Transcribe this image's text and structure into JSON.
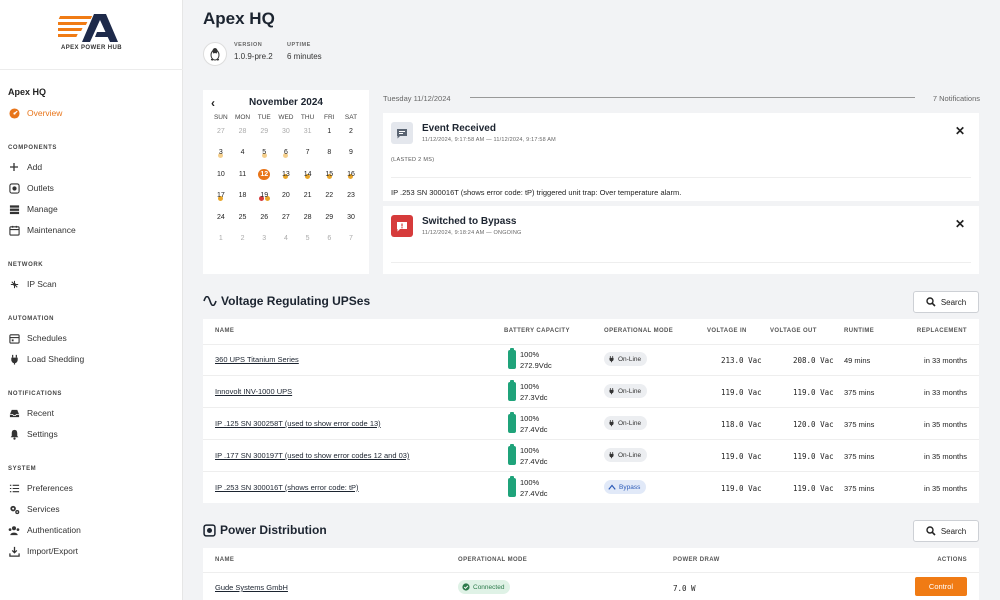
{
  "app": {
    "logo_text": "APEX POWER HUB"
  },
  "header": {
    "title": "Apex HQ",
    "version_label": "VERSION",
    "version": "1.0.9-pre.2",
    "uptime_label": "UPTIME",
    "uptime": "6 minutes"
  },
  "sidebar": {
    "site": "Apex HQ",
    "overview": "Overview",
    "sections": {
      "components": "COMPONENTS",
      "network": "NETWORK",
      "automation": "AUTOMATION",
      "notifications": "NOTIFICATIONS",
      "system": "SYSTEM"
    },
    "items": {
      "add": "Add",
      "outlets": "Outlets",
      "manage": "Manage",
      "maintenance": "Maintenance",
      "ip_scan": "IP Scan",
      "schedules": "Schedules",
      "load_shedding": "Load Shedding",
      "recent": "Recent",
      "settings": "Settings",
      "preferences": "Preferences",
      "services": "Services",
      "authentication": "Authentication",
      "import_export": "Import/Export"
    }
  },
  "calendar": {
    "title": "November 2024",
    "days": [
      "SUN",
      "MON",
      "TUE",
      "WED",
      "THU",
      "FRI",
      "SAT"
    ],
    "weeks": [
      [
        "27",
        "28",
        "29",
        "30",
        "31",
        "1",
        "2"
      ],
      [
        "3",
        "4",
        "5",
        "6",
        "7",
        "8",
        "9"
      ],
      [
        "10",
        "11",
        "12",
        "13",
        "14",
        "15",
        "16"
      ],
      [
        "17",
        "18",
        "19",
        "20",
        "21",
        "22",
        "23"
      ],
      [
        "24",
        "25",
        "26",
        "27",
        "28",
        "29",
        "30"
      ],
      [
        "1",
        "2",
        "3",
        "4",
        "5",
        "6",
        "7"
      ]
    ],
    "today": "12"
  },
  "notifications": {
    "date": "Tuesday 11/12/2024",
    "count": "7 Notifications",
    "items": [
      {
        "title": "Event Received",
        "time": "11/12/2024, 9:17:58 AM   —   11/12/2024, 9:17:58 AM",
        "lasted": "(LASTED 2 MS)",
        "message": "IP .253 SN 300016T (shows error code: tP) triggered unit trap: Over temperature alarm."
      },
      {
        "title": "Switched to Bypass",
        "time": "11/12/2024, 9:18:24 AM   —   ONGOING"
      }
    ]
  },
  "ups": {
    "title": "Voltage Regulating UPSes",
    "search_label": "Search",
    "columns": [
      "NAME",
      "BATTERY CAPACITY",
      "OPERATIONAL MODE",
      "VOLTAGE IN",
      "VOLTAGE OUT",
      "RUNTIME",
      "REPLACEMENT"
    ],
    "rows": [
      {
        "name": "360 UPS Titanium Series",
        "battery_pct": "100%",
        "battery_v": "272.9Vdc",
        "mode": "On-Line",
        "vin": "213.0 Vac",
        "vout": "208.0 Vac",
        "runtime": "49 mins",
        "replacement": "in 33 months"
      },
      {
        "name": "Innovolt INV-1000 UPS",
        "battery_pct": "100%",
        "battery_v": "27.3Vdc",
        "mode": "On-Line",
        "vin": "119.0 Vac",
        "vout": "119.0 Vac",
        "runtime": "375 mins",
        "replacement": "in 33 months"
      },
      {
        "name": "IP .125 SN 300258T (used to show error code 13)",
        "battery_pct": "100%",
        "battery_v": "27.4Vdc",
        "mode": "On-Line",
        "vin": "118.0 Vac",
        "vout": "120.0 Vac",
        "runtime": "375 mins",
        "replacement": "in 35 months"
      },
      {
        "name": "IP .177 SN 300197T (used to show error codes 12 and 03)",
        "battery_pct": "100%",
        "battery_v": "27.4Vdc",
        "mode": "On-Line",
        "vin": "119.0 Vac",
        "vout": "119.0 Vac",
        "runtime": "375 mins",
        "replacement": "in 35 months"
      },
      {
        "name": "IP .253 SN 300016T (shows error code: tP)",
        "battery_pct": "100%",
        "battery_v": "27.4Vdc",
        "mode": "Bypass",
        "vin": "119.0 Vac",
        "vout": "119.0 Vac",
        "runtime": "375 mins",
        "replacement": "in 35 months"
      }
    ]
  },
  "pdu": {
    "title": "Power Distribution",
    "search_label": "Search",
    "columns": [
      "NAME",
      "OPERATIONAL MODE",
      "POWER DRAW",
      "ACTIONS"
    ],
    "rows": [
      {
        "name": "Gude Systems GmbH",
        "mode": "Connected",
        "power": "7.0 W",
        "action": "Control"
      }
    ]
  },
  "colors": {
    "accent": "#f07b14",
    "battery": "#1fa37a",
    "bypass": "#2c5bb8",
    "alert": "#d63b3b"
  }
}
